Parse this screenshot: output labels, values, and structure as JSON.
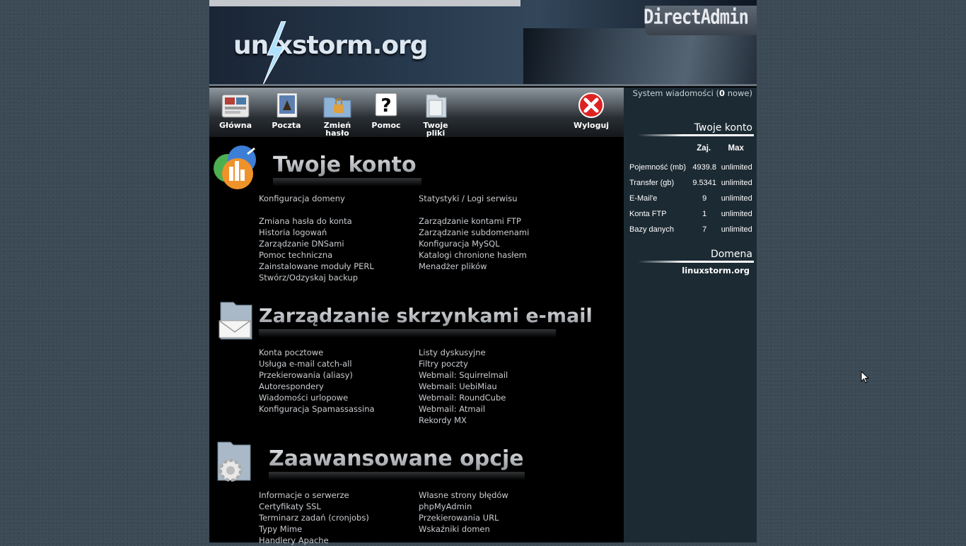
{
  "header": {
    "site_logo": "un xstorm.org",
    "brand": "DirectAdmin"
  },
  "nav": [
    {
      "label": "Główna",
      "icon": "home-icon"
    },
    {
      "label": "Poczta",
      "icon": "mail-stamp-icon"
    },
    {
      "label": "Zmień hasło",
      "icon": "lock-folder-icon"
    },
    {
      "label": "Pomoc",
      "icon": "help-icon"
    },
    {
      "label": "Twoje pliki",
      "icon": "files-icon"
    },
    {
      "label": "Wyloguj",
      "icon": "logout-icon"
    }
  ],
  "messages": {
    "prefix": "System wiadomości (",
    "count": "0",
    "suffix": " nowe)"
  },
  "account_panel": {
    "title": "Twoje konto",
    "headers": [
      "Zaj.",
      "Max"
    ],
    "rows": [
      {
        "label": "Pojemność (mb)",
        "used": "4939.8",
        "max": "unlimited"
      },
      {
        "label": "Transfer (gb)",
        "used": "9.5341",
        "max": "unlimited"
      },
      {
        "label": "E-Mail'e",
        "used": "9",
        "max": "unlimited"
      },
      {
        "label": "Konta FTP",
        "used": "1",
        "max": "unlimited"
      },
      {
        "label": "Bazy danych",
        "used": "7",
        "max": "unlimited"
      }
    ]
  },
  "domain_panel": {
    "title": "Domena",
    "domain": "linuxstorm.org"
  },
  "sections": [
    {
      "title": "Twoje konto",
      "icon": "stats-chart-icon",
      "left": [
        "Konfiguracja domeny",
        "",
        "Zmiana hasła do konta",
        "Historia logowań",
        "Zarządzanie DNSami",
        "Pomoc techniczna",
        "Zainstalowane moduły PERL",
        "Stwórz/Odzyskaj backup"
      ],
      "right": [
        "Statystyki / Logi serwisu",
        "",
        "Zarządzanie kontami FTP",
        "Zarządzanie subdomenami",
        "Konfiguracja MySQL",
        "Katalogi chronione hasłem",
        "Menadżer plików"
      ]
    },
    {
      "title": "Zarządzanie skrzynkami e-mail",
      "icon": "mail-folder-icon",
      "left": [
        "Konta pocztowe",
        "Usługa e-mail catch-all",
        "Przekierowania (aliasy)",
        "Autorespondery",
        "Wiadomości urlopowe",
        "Konfiguracja Spamassassina"
      ],
      "right": [
        "Listy dyskusyjne",
        "Filtry poczty",
        "Webmail: Squirrelmail",
        "Webmail: UebiMiau",
        "Webmail: RoundCube",
        "Webmail: Atmail",
        "Rekordy MX"
      ]
    },
    {
      "title": "Zaawansowane opcje",
      "icon": "gear-folder-icon",
      "left": [
        "Informacje o serwerze",
        "Certyfikaty SSL",
        "Terminarz zadań (cronjobs)",
        "Typy Mime",
        "Handlery Apache"
      ],
      "right": [
        "Własne strony błędów",
        "phpMyAdmin",
        "Przekierowania URL",
        "Wskaźniki domen"
      ]
    }
  ]
}
